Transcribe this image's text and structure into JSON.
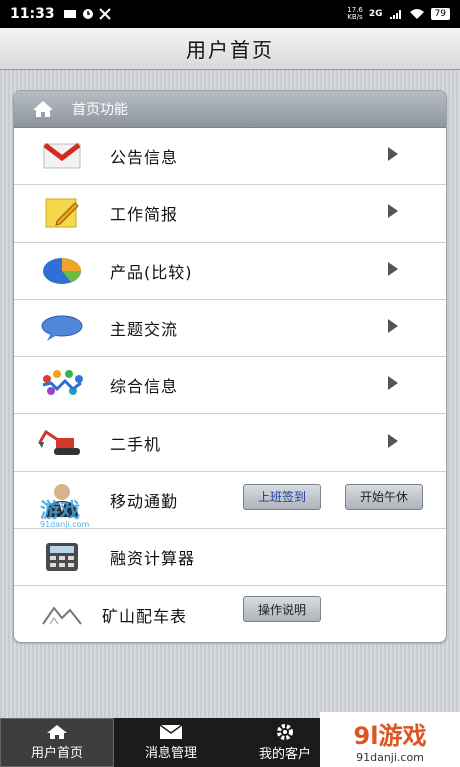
{
  "status": {
    "time": "11:33",
    "network": "2G",
    "speed": "17.6\nKB/s",
    "battery": "79"
  },
  "title": "用户首页",
  "panel": {
    "header": "首页功能"
  },
  "items": [
    {
      "label": "公告信息",
      "icon": "mail-icon"
    },
    {
      "label": "工作简报",
      "icon": "notepad-icon"
    },
    {
      "label": "产品(比较)",
      "icon": "pie-chart-icon"
    },
    {
      "label": "主题交流",
      "icon": "chat-bubble-icon"
    },
    {
      "label": "综合信息",
      "icon": "people-icon"
    },
    {
      "label": "二手机",
      "icon": "excavator-icon"
    },
    {
      "label": "移动通勤",
      "icon": "user-avatar-icon"
    },
    {
      "label": "融资计算器",
      "icon": "calculator-icon"
    },
    {
      "label": "矿山配车表",
      "icon": "mountain-icon"
    }
  ],
  "buttons": {
    "checkin": "上班签到",
    "lunch": "开始午休",
    "manual": "操作说明"
  },
  "tabs": [
    {
      "label": "用户首页",
      "icon": "home-icon"
    },
    {
      "label": "消息管理",
      "icon": "envelope-icon"
    },
    {
      "label": "我的客户",
      "icon": "gear-icon"
    }
  ],
  "watermark": {
    "small": "游戏",
    "small_url": "91danji.com",
    "big": "9l游戏",
    "big_url": "91danji.com"
  }
}
